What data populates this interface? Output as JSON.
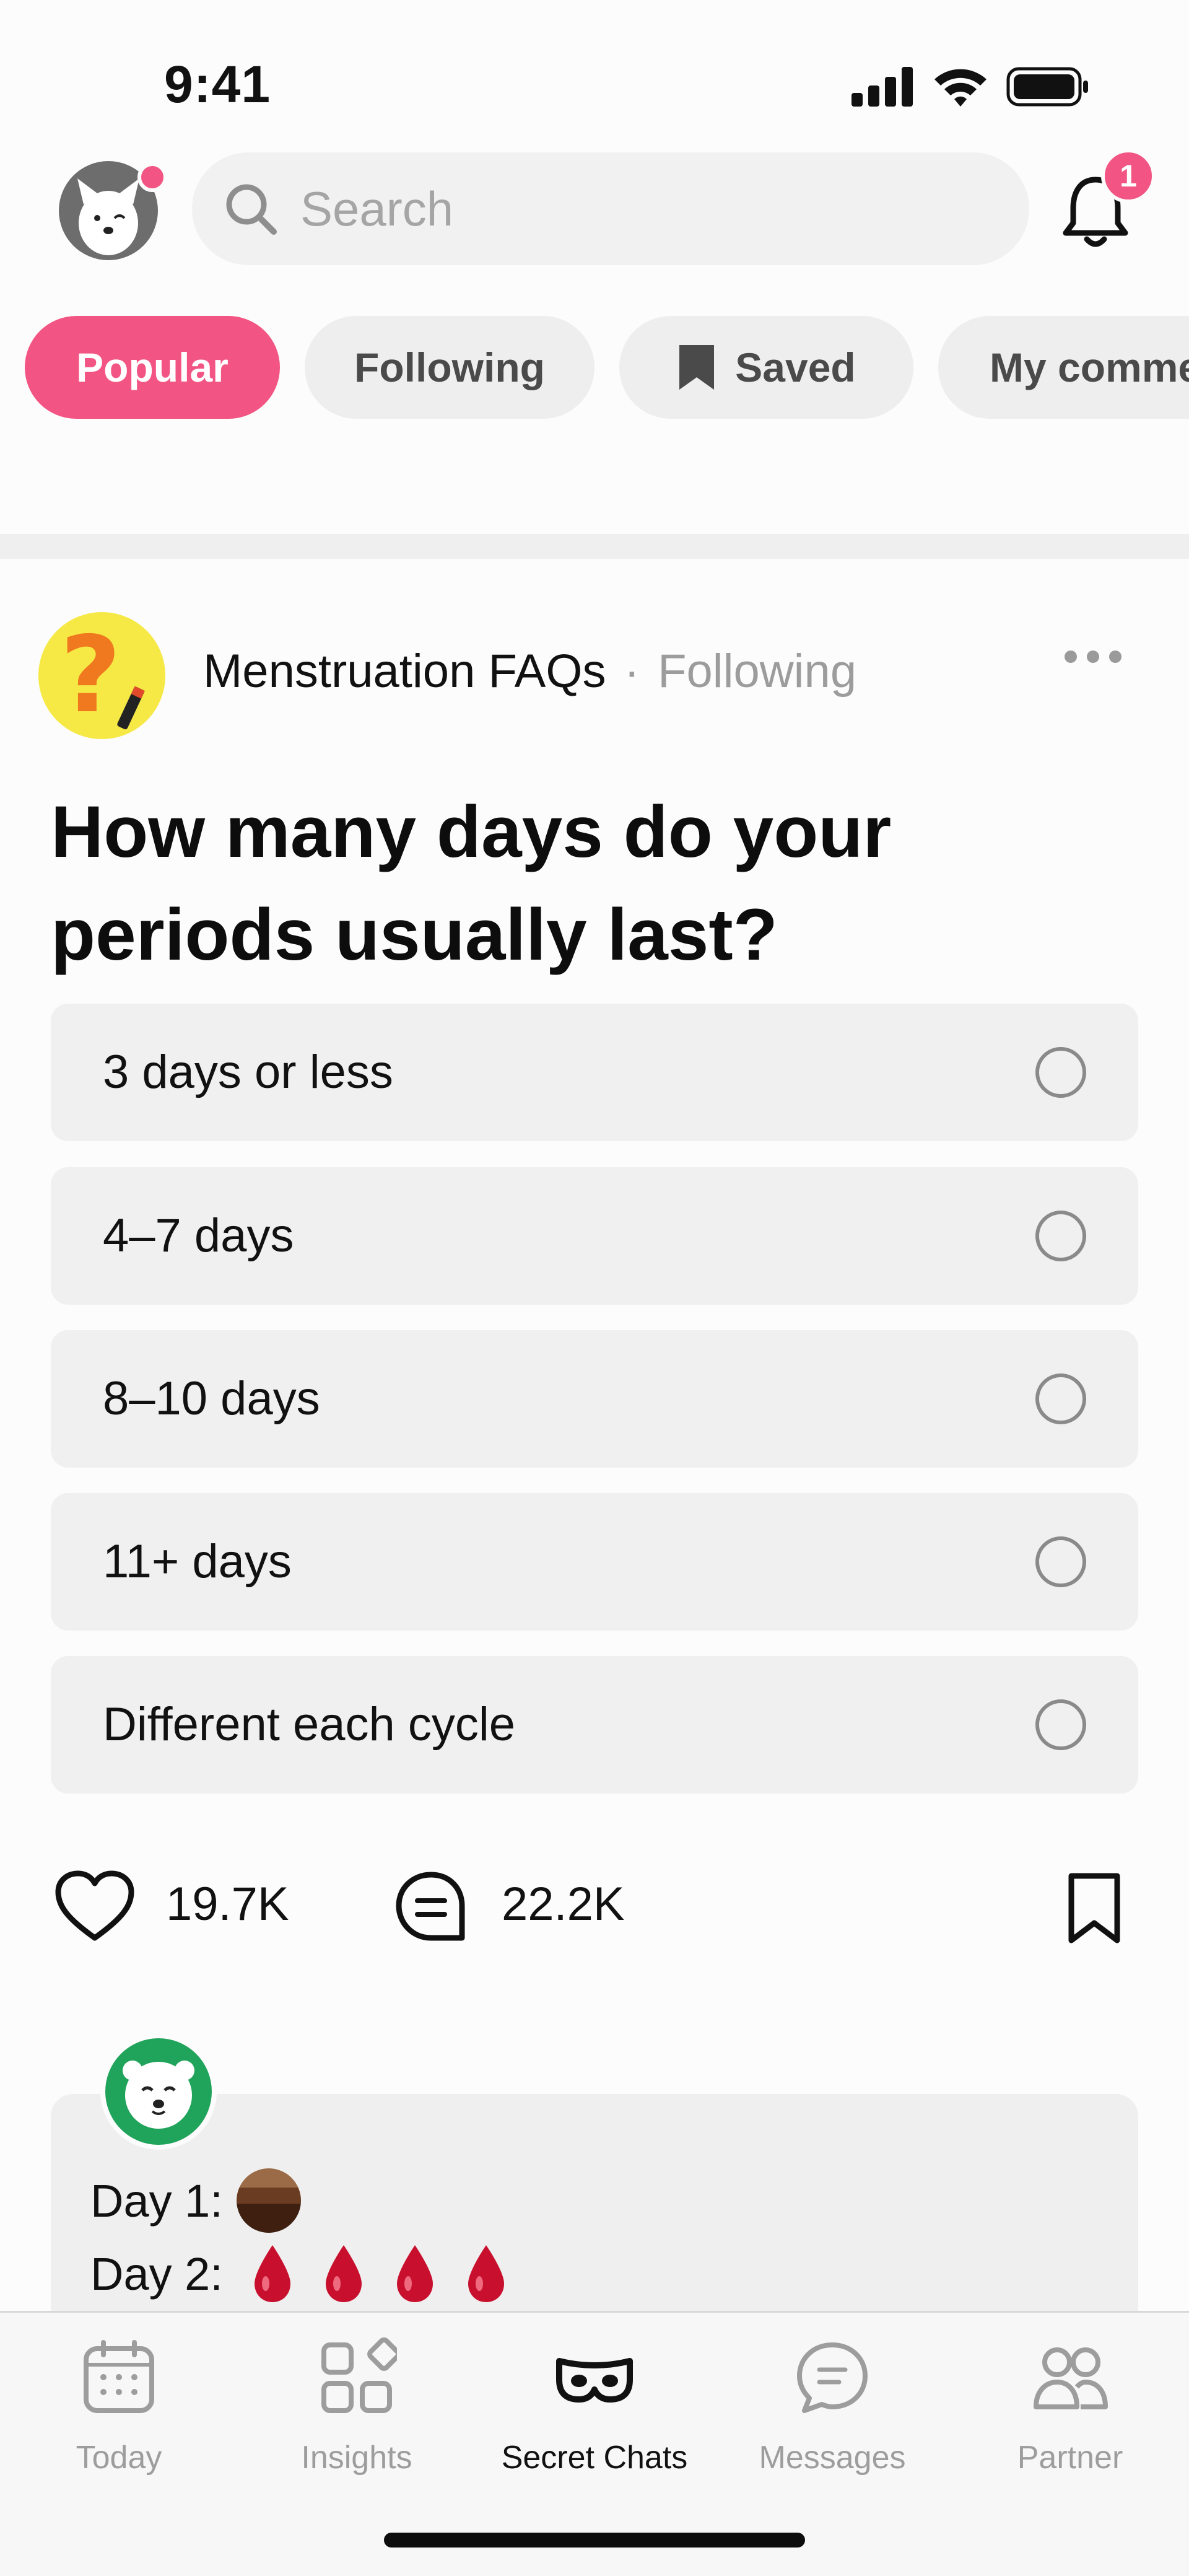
{
  "status_bar": {
    "time": "9:41"
  },
  "header": {
    "search_placeholder": "Search",
    "notification_count": "1"
  },
  "filters": {
    "popular": "Popular",
    "following": "Following",
    "saved": "Saved",
    "my_comments": "My comme"
  },
  "post": {
    "community": "Menstruation FAQs",
    "separator": "·",
    "follow_status": "Following",
    "title": "How many days do your periods usually last?",
    "options": [
      {
        "label": "3 days or less"
      },
      {
        "label": "4–7 days"
      },
      {
        "label": "8–10 days"
      },
      {
        "label": "11+ days"
      },
      {
        "label": "Different each cycle"
      }
    ],
    "likes": "19.7K",
    "comments": "22.2K"
  },
  "comment_preview": {
    "line1": "Day 1:",
    "line2": "Day 2:"
  },
  "tab_bar": {
    "today": "Today",
    "insights": "Insights",
    "secret_chats": "Secret Chats",
    "messages": "Messages",
    "partner": "Partner",
    "active": "secret_chats"
  },
  "colors": {
    "accent": "#f25583",
    "chip_bg": "#eeeeee",
    "option_bg": "#f0f0f0",
    "commenter_avatar": "#20a35a",
    "community_avatar": "#f6e946"
  },
  "icons": {
    "signal": "cellular-signal-icon",
    "wifi": "wifi-icon",
    "battery": "battery-icon",
    "search": "search-icon",
    "bell": "bell-icon",
    "saved": "bookmark-icon",
    "more": "more-dots-icon",
    "like": "heart-icon",
    "comment": "comment-icon",
    "bookmark": "bookmark-icon"
  }
}
